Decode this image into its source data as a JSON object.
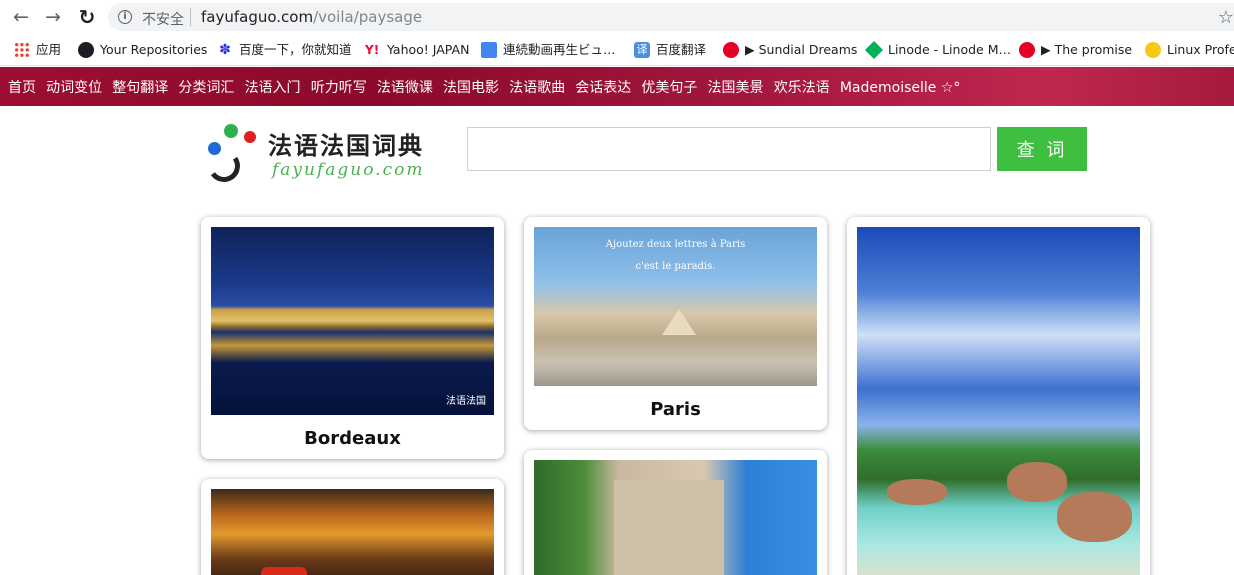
{
  "browser": {
    "insecure_label": "不安全",
    "url_host": "fayufaguo.com",
    "url_path": "/voila/paysage"
  },
  "bookmarks": [
    {
      "label": "应用",
      "icon": "apps-icon"
    },
    {
      "label": "Your Repositories",
      "icon": "github-icon"
    },
    {
      "label": "百度一下，你就知道",
      "icon": "baidu-icon"
    },
    {
      "label": "Yahoo! JAPAN",
      "icon": "yahoo-icon"
    },
    {
      "label": "連続動画再生ビュ…",
      "icon": "doc-icon"
    },
    {
      "label": "百度翻译",
      "icon": "translate-icon"
    },
    {
      "label": "▶ Sundial Dreams",
      "icon": "netease-icon"
    },
    {
      "label": "Linode - Linode M…",
      "icon": "linode-icon"
    },
    {
      "label": "▶ The promise",
      "icon": "netease-icon"
    },
    {
      "label": "Linux Profes",
      "icon": "linux-icon"
    }
  ],
  "site_nav": [
    "首页",
    "动词变位",
    "整句翻译",
    "分类词汇",
    "法语入门",
    "听力听写",
    "法语微课",
    "法国电影",
    "法语歌曲",
    "会话表达",
    "优美句子",
    "法国美景",
    "欢乐法语",
    "Mademoiselle ☆°"
  ],
  "logo": {
    "title": "法语法国词典",
    "subtitle": "fayufaguo.com"
  },
  "search": {
    "value": "",
    "button_label": "查 词"
  },
  "cards": [
    {
      "caption": "Bordeaux",
      "watermark": "法语法国"
    },
    {
      "caption": "Paris",
      "overlay_line1": "Ajoutez deux lettres à Paris",
      "overlay_line2": "c'est le paradis."
    }
  ],
  "colors": {
    "nav_bar": "#9c0e32",
    "search_button": "#3fbf3f"
  }
}
